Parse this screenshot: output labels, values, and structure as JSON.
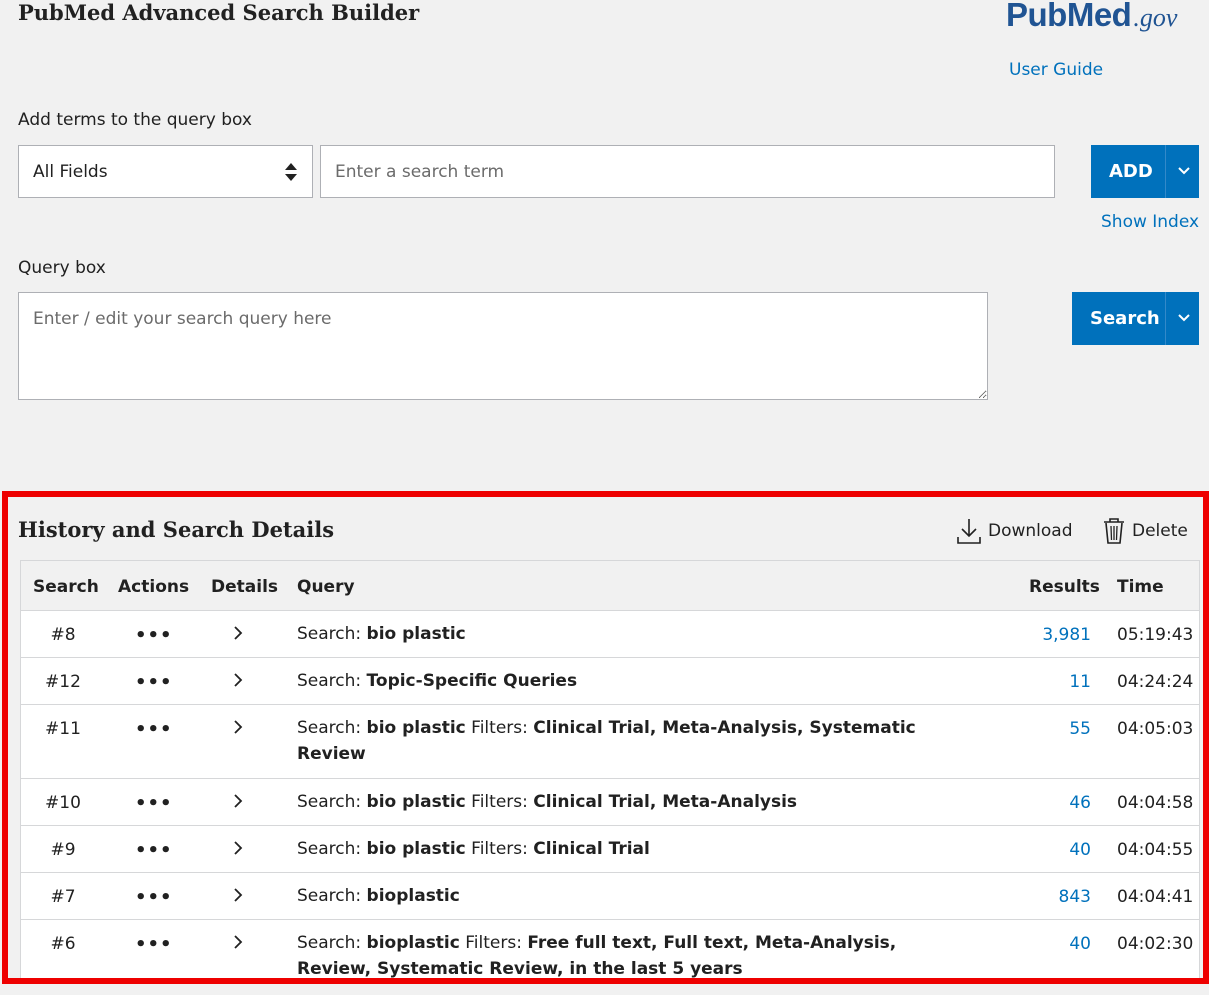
{
  "header": {
    "title": "PubMed Advanced Search Builder",
    "logo_main": "PubMed",
    "logo_suffix": ".gov",
    "user_guide": "User Guide"
  },
  "builder": {
    "add_terms_label": "Add terms to the query box",
    "field_select_value": "All Fields",
    "term_placeholder": "Enter a search term",
    "add_button": "ADD",
    "show_index": "Show Index",
    "query_box_label": "Query box",
    "query_placeholder": "Enter / edit your search query here",
    "search_button": "Search"
  },
  "history": {
    "title": "History and Search Details",
    "download": "Download",
    "delete": "Delete",
    "columns": [
      "Search",
      "Actions",
      "Details",
      "Query",
      "Results",
      "Time"
    ],
    "rows": [
      {
        "num": "#8",
        "actions": "•••",
        "segments": [
          {
            "t": "Search: ",
            "b": false
          },
          {
            "t": "bio plastic",
            "b": true
          }
        ],
        "results": "3,981",
        "time": "05:19:43",
        "height": 47
      },
      {
        "num": "#12",
        "actions": "•••",
        "segments": [
          {
            "t": "Search: ",
            "b": false
          },
          {
            "t": "Topic-Specific Queries",
            "b": true
          }
        ],
        "results": "11",
        "time": "04:24:24",
        "height": 47
      },
      {
        "num": "#11",
        "actions": "•••",
        "segments": [
          {
            "t": "Search: ",
            "b": false
          },
          {
            "t": "bio plastic",
            "b": true
          },
          {
            "t": " Filters: ",
            "b": false
          },
          {
            "t": "Clinical Trial, Meta-Analysis, Systematic Review",
            "b": true
          }
        ],
        "results": "55",
        "time": "04:05:03",
        "height": 74
      },
      {
        "num": "#10",
        "actions": "•••",
        "segments": [
          {
            "t": "Search: ",
            "b": false
          },
          {
            "t": "bio plastic",
            "b": true
          },
          {
            "t": " Filters: ",
            "b": false
          },
          {
            "t": "Clinical Trial, Meta-Analysis",
            "b": true
          }
        ],
        "results": "46",
        "time": "04:04:58",
        "height": 47
      },
      {
        "num": "#9",
        "actions": "•••",
        "segments": [
          {
            "t": "Search: ",
            "b": false
          },
          {
            "t": "bio plastic",
            "b": true
          },
          {
            "t": " Filters: ",
            "b": false
          },
          {
            "t": "Clinical Trial",
            "b": true
          }
        ],
        "results": "40",
        "time": "04:04:55",
        "height": 47
      },
      {
        "num": "#7",
        "actions": "•••",
        "segments": [
          {
            "t": "Search: ",
            "b": false
          },
          {
            "t": "bioplastic",
            "b": true
          }
        ],
        "results": "843",
        "time": "04:04:41",
        "height": 47
      },
      {
        "num": "#6",
        "actions": "•••",
        "segments": [
          {
            "t": "Search: ",
            "b": false
          },
          {
            "t": "bioplastic",
            "b": true
          },
          {
            "t": " Filters: ",
            "b": false
          },
          {
            "t": "Free full text, Full text, Meta-Analysis, Review, Systematic Review, in the last 5 years",
            "b": true
          }
        ],
        "results": "40",
        "time": "04:02:30",
        "height": 74
      }
    ]
  },
  "colors": {
    "accent": "#0071bc",
    "highlight_border": "#ee0000",
    "background": "#f1f1f1"
  },
  "icons": {
    "download": "download-icon",
    "delete": "trash-icon",
    "select_arrows": "sort-arrows-icon",
    "dropdown": "chevron-down-icon",
    "details": "chevron-right-icon"
  }
}
